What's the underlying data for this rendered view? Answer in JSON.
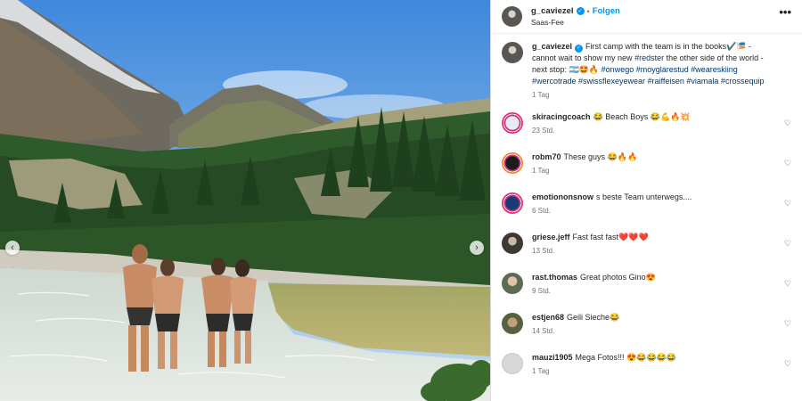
{
  "post": {
    "username": "g_caviezel",
    "follow_label": "Folgen",
    "location": "Saas-Fee",
    "verified_mark": "✓",
    "more_label": "•••"
  },
  "photo_nav": {
    "prev": "‹",
    "next": "›"
  },
  "caption": {
    "username": "g_caviezel",
    "text_1": "First camp with the team is in the books✔️🎏 - cannot wait to show my new",
    "hashtag_redster": "#redster",
    "text_2": "the other side of the world - next stop: 🇦🇷🤩🔥",
    "hashtags": "#onwego #moyglarestud #weareskiing #wercotrade #swissflexeyewear #raiffeisen #viamala #crossequip",
    "time": "1 Tag"
  },
  "comments": [
    {
      "username": "skiracingcoach",
      "text": "😂 Beach Boys 😂💪🔥💥",
      "time": "23 Std.",
      "avatar": "ski-avatar"
    },
    {
      "username": "robm70",
      "text": "These guys 😂🔥🔥",
      "time": "1 Tag",
      "avatar": "robm-avatar"
    },
    {
      "username": "emotiononsnow",
      "text": "s beste Team unterwegs....",
      "time": "6 Std.",
      "avatar": "motion-avatar"
    },
    {
      "username": "griese.jeff",
      "text": "Fast fast fast❤️❤️❤️",
      "time": "13 Std.",
      "avatar": "griese-avatar"
    },
    {
      "username": "rast.thomas",
      "text": "Great photos Gino😍",
      "time": "9 Std.",
      "avatar": "rast-avatar"
    },
    {
      "username": "estjen68",
      "text": "Geili Sieche😂",
      "time": "14 Std.",
      "avatar": "estjen-avatar"
    },
    {
      "username": "mauzi1905",
      "text": "Mega Fotos!!! 😍😂😂😂😂",
      "time": "1 Tag",
      "avatar": "mauzi-avatar"
    }
  ],
  "heart_icon": "♡",
  "colors": {
    "link": "#0095f6",
    "hashtag": "#00376b",
    "muted": "#737373"
  }
}
